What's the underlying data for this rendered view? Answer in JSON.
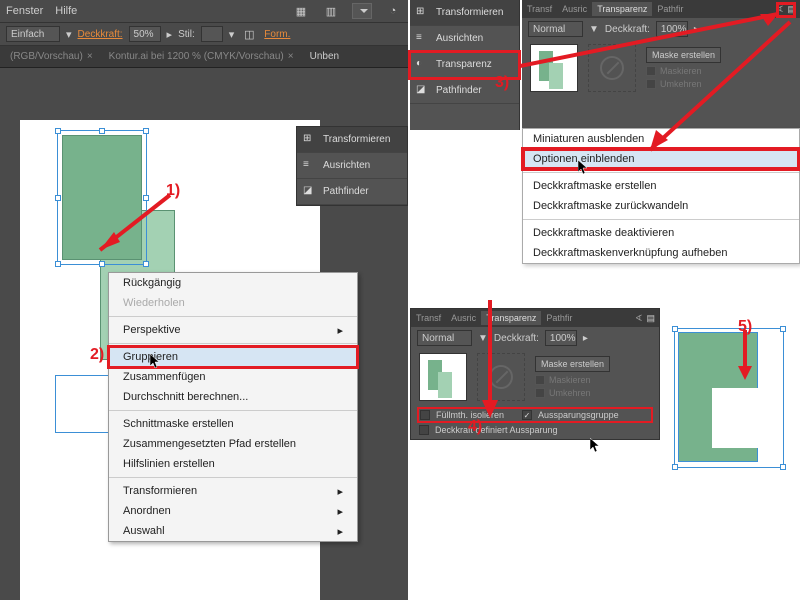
{
  "menubar": {
    "fenster": "Fenster",
    "hilfe": "Hilfe"
  },
  "controlbar": {
    "preset": "Einfach",
    "deckkraft_label": "Deckkraft:",
    "deckkraft_value": "50%",
    "stil_label": "Stil:",
    "formel": "Form."
  },
  "tabs": {
    "tab1": "(RGB/Vorschau)",
    "tab2": "Kontur.ai bei 1200 % (CMYK/Vorschau)",
    "tab3": "Unben"
  },
  "side_panel": {
    "transformieren": "Transformieren",
    "ausrichten": "Ausrichten",
    "transparenz": "Transparenz",
    "pathfinder": "Pathfinder"
  },
  "context_menu": {
    "rueckgaengig": "Rückgängig",
    "wiederholen": "Wiederholen",
    "perspektive": "Perspektive",
    "gruppieren": "Gruppieren",
    "zusammenfuegen": "Zusammenfügen",
    "durchschnitt": "Durchschnitt berechnen...",
    "schnittmaske": "Schnittmaske erstellen",
    "pfad": "Zusammengesetzten Pfad erstellen",
    "hilfslinien": "Hilfslinien erstellen",
    "transformieren": "Transformieren",
    "anordnen": "Anordnen",
    "auswahl": "Auswahl"
  },
  "transp_panel": {
    "tabs": {
      "transf": "Transf",
      "ausric": "Ausric",
      "transparenz": "Transparenz",
      "pathfir": "Pathfir"
    },
    "mode": "Normal",
    "deckkraft_label": "Deckkraft:",
    "deckkraft_value": "100%",
    "maske_erstellen": "Maske erstellen",
    "maskieren": "Maskieren",
    "umkehren": "Umkehren",
    "fuellmth": "Füllmth. isolieren",
    "aussparung": "Aussparungsgruppe",
    "deckkraft_def": "Deckkraft definiert Aussparung"
  },
  "panel_menu": {
    "miniaturen": "Miniaturen ausblenden",
    "optionen": "Optionen einblenden",
    "dkm_erstellen": "Deckkraftmaske erstellen",
    "dkm_zurueck": "Deckkraftmaske zurückwandeln",
    "dkm_deakt": "Deckkraftmaske deaktivieren",
    "dkm_verkn": "Deckkraftmaskenverknüpfung aufheben"
  },
  "annotations": {
    "a1": "1)",
    "a2": "2)",
    "a3": "3)",
    "a4": "4)",
    "a5": "5)"
  }
}
